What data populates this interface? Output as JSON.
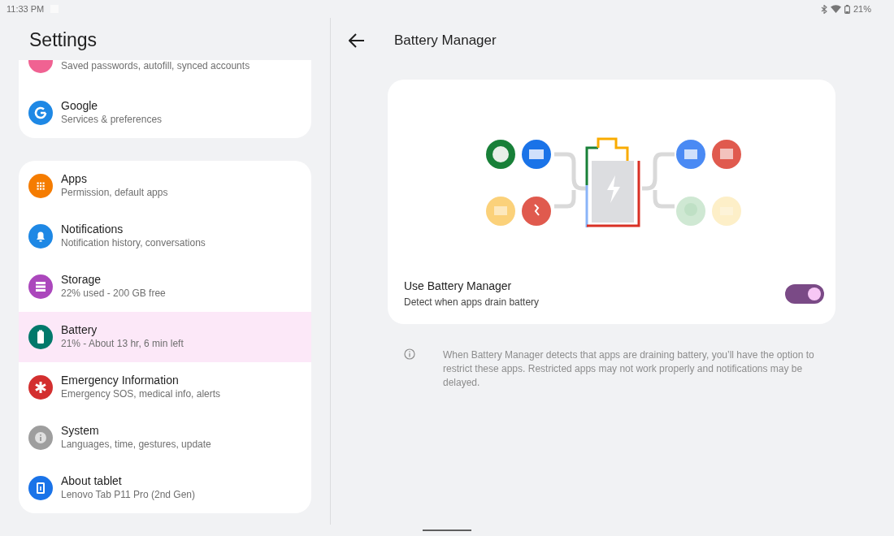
{
  "status_bar": {
    "time": "11:33 PM",
    "battery": "21%"
  },
  "sidebar": {
    "title": "Settings",
    "groups": [
      {
        "items": [
          {
            "subtitle": "Saved passwords, autofill, synced accounts",
            "color": "#f06292",
            "selected": false
          },
          {
            "title": "Google",
            "subtitle": "Services & preferences",
            "color": "#1e88e5",
            "selected": false
          }
        ]
      },
      {
        "items": [
          {
            "title": "Apps",
            "subtitle": "Permission, default apps",
            "color": "#f57c00",
            "selected": false
          },
          {
            "title": "Notifications",
            "subtitle": "Notification history, conversations",
            "color": "#1e88e5",
            "selected": false
          },
          {
            "title": "Storage",
            "subtitle": "22% used - 200 GB free",
            "color": "#ab47bc",
            "selected": false
          },
          {
            "title": "Battery",
            "subtitle": "21% - About 13 hr, 6 min left",
            "color": "#00796b",
            "selected": true
          },
          {
            "title": "Emergency Information",
            "subtitle": "Emergency SOS, medical info, alerts",
            "color": "#d32f2f",
            "selected": false
          },
          {
            "title": "System",
            "subtitle": "Languages, time, gestures, update",
            "color": "#9e9e9e",
            "selected": false
          },
          {
            "title": "About tablet",
            "subtitle": "Lenovo Tab P11 Pro (2nd Gen)",
            "color": "#1a73e8",
            "selected": false
          }
        ]
      }
    ]
  },
  "detail": {
    "title": "Battery Manager",
    "setting": {
      "title": "Use Battery Manager",
      "subtitle": "Detect when apps drain battery",
      "on": true
    },
    "info": "When Battery Manager detects that apps are draining battery, you’ll have the option to restrict these apps. Restricted apps may not work properly and notifications may be delayed."
  }
}
